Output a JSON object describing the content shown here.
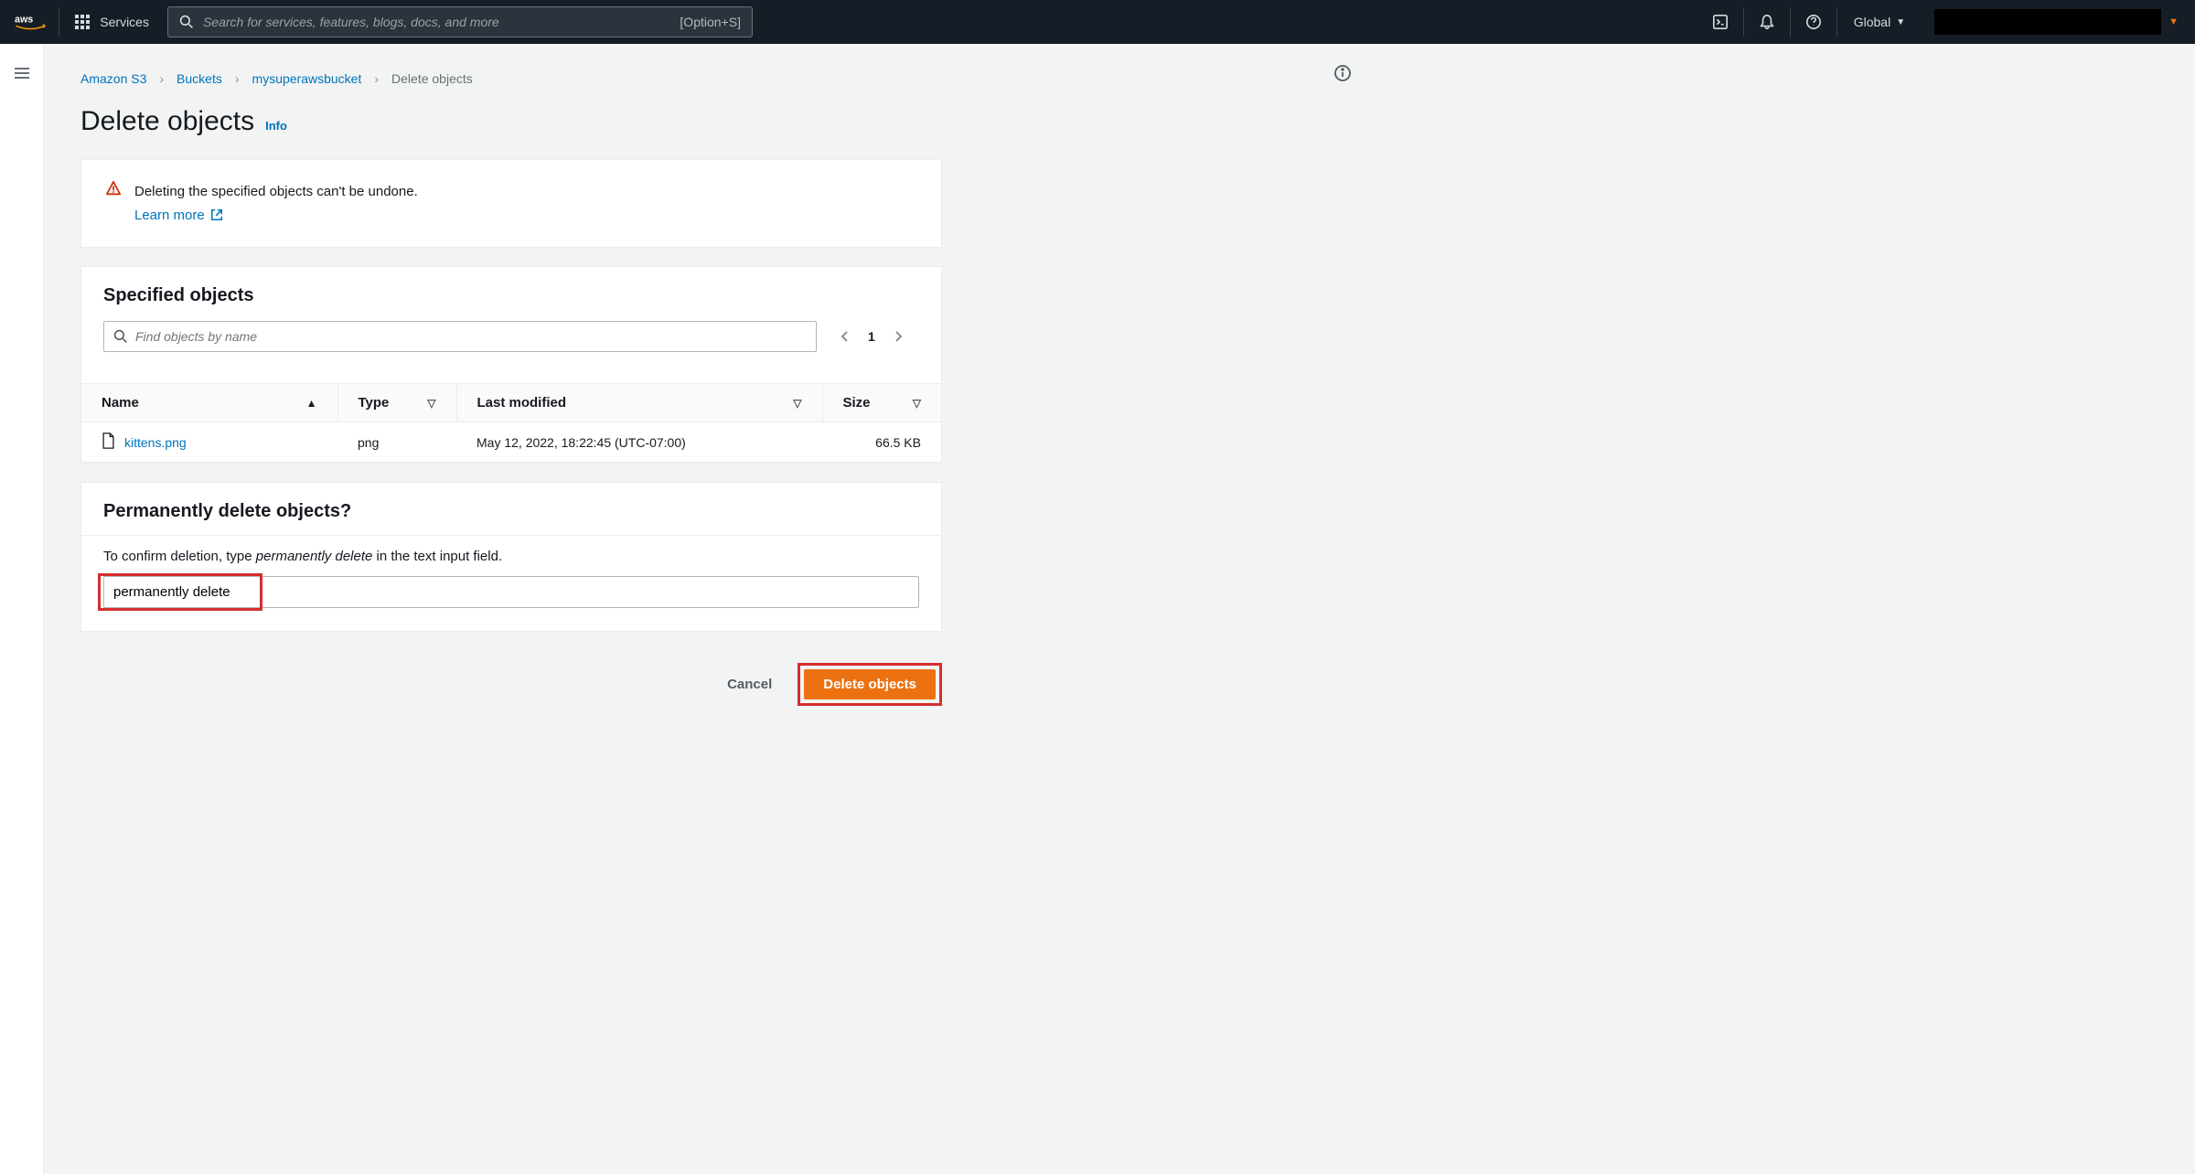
{
  "nav": {
    "services_label": "Services",
    "search_placeholder": "Search for services, features, blogs, docs, and more",
    "search_shortcut": "[Option+S]",
    "region": "Global"
  },
  "breadcrumb": {
    "root": "Amazon S3",
    "buckets": "Buckets",
    "bucket_name": "mysuperawsbucket",
    "current": "Delete objects"
  },
  "page": {
    "title": "Delete objects",
    "info_link": "Info"
  },
  "warning": {
    "text": "Deleting the specified objects can't be undone.",
    "learn_more": "Learn more"
  },
  "specified": {
    "title": "Specified objects",
    "filter_placeholder": "Find objects by name",
    "page": "1",
    "columns": {
      "name": "Name",
      "type": "Type",
      "last_modified": "Last modified",
      "size": "Size"
    },
    "row": {
      "name": "kittens.png",
      "type": "png",
      "last_modified": "May 12, 2022, 18:22:45 (UTC-07:00)",
      "size": "66.5 KB"
    }
  },
  "confirm": {
    "title": "Permanently delete objects?",
    "instruction_prefix": "To confirm deletion, type ",
    "instruction_keyword": "permanently delete",
    "instruction_suffix": " in the text input field.",
    "input_value": "permanently delete"
  },
  "footer": {
    "cancel": "Cancel",
    "submit": "Delete objects"
  }
}
